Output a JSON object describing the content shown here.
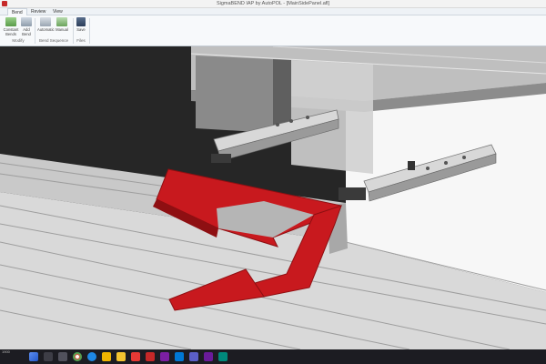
{
  "window": {
    "title": "SigmaBEND IAP by AutoPOL - [MainSidePanel.afl]"
  },
  "tabs": [
    {
      "label": "Bend"
    },
    {
      "label": "Review"
    },
    {
      "label": "View"
    }
  ],
  "ribbon": {
    "buttons": [
      {
        "label": "Constant Bends"
      },
      {
        "label": "Add Bend"
      },
      {
        "label": "Automatic"
      },
      {
        "label": "Manual"
      },
      {
        "label": "Save"
      }
    ],
    "groups": [
      {
        "label": "Modify"
      },
      {
        "label": "Bend Sequence"
      },
      {
        "label": "Files"
      }
    ]
  },
  "colors": {
    "part": "#c8191e",
    "part_dark": "#8e0f12",
    "accent": "#2b6cb0"
  },
  "status": {
    "text": "1900"
  },
  "taskbar": {
    "icons": [
      "start-icon",
      "search-icon",
      "task-view-icon",
      "chrome-icon",
      "edge-icon",
      "wifi-icon",
      "file-explorer-icon",
      "app-icon",
      "autopol-icon",
      "app-icon",
      "outlook-icon",
      "teams-icon",
      "app-icon",
      "app-icon"
    ]
  }
}
